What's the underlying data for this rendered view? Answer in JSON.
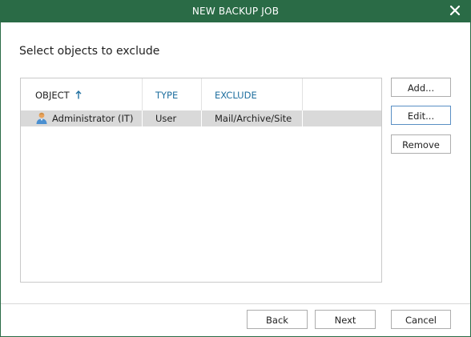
{
  "window": {
    "title": "NEW BACKUP JOB",
    "close_icon": "close-icon",
    "titlebar_color": "#2a6b46"
  },
  "page": {
    "heading": "Select objects to exclude"
  },
  "grid": {
    "columns": [
      {
        "label": "OBJECT",
        "sort": "ascending"
      },
      {
        "label": "TYPE"
      },
      {
        "label": "EXCLUDE"
      }
    ],
    "rows": [
      {
        "icon": "user-icon",
        "object": "Administrator (IT)",
        "type": "User",
        "exclude": "Mail/Archive/Site",
        "selected": true
      }
    ]
  },
  "side_buttons": {
    "add": "Add...",
    "edit": "Edit...",
    "remove": "Remove"
  },
  "footer": {
    "back": "Back",
    "next": "Next",
    "cancel": "Cancel"
  },
  "colors": {
    "accent_header": "#1f6f9f",
    "selected_row": "#d9d9d9"
  }
}
